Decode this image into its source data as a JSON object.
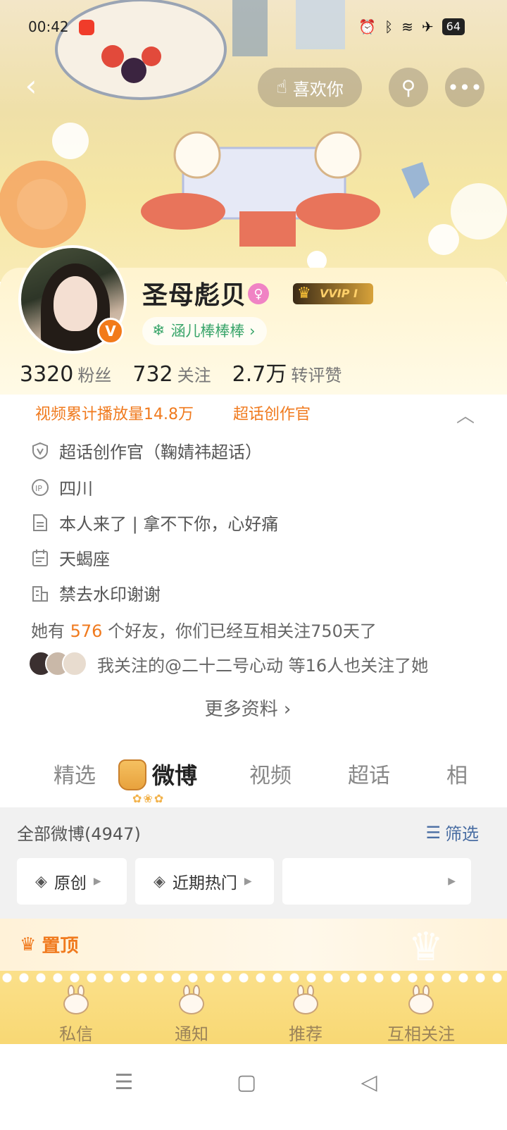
{
  "status_bar": {
    "time": "00:42",
    "battery": "64"
  },
  "top_nav": {
    "back_icon": "chevron-left-icon",
    "like_label": "喜欢你",
    "search_icon": "search-icon",
    "more_icon": "more-dots-icon"
  },
  "profile": {
    "username": "圣母彪贝",
    "gender": "female",
    "vip_label": "VVIP I",
    "fan_badge": "涵儿棒棒棒 ›",
    "stats": [
      {
        "value": "3320",
        "label": "粉丝"
      },
      {
        "value": "732",
        "label": "关注"
      },
      {
        "value": "2.7万",
        "label": "转评赞"
      }
    ]
  },
  "info": {
    "tags": [
      "视频累计播放量14.8万",
      "超话创作官"
    ],
    "rows": [
      {
        "icon": "shield-v-icon",
        "text": "超话创作官（鞠婧祎超话）"
      },
      {
        "icon": "ip-icon",
        "text": "四川"
      },
      {
        "icon": "document-icon",
        "text": "本人来了 | 拿不下你，心好痛"
      },
      {
        "icon": "calendar-icon",
        "text": "天蝎座"
      },
      {
        "icon": "building-icon",
        "text": "禁去水印谢谢"
      }
    ],
    "friends_prefix": "她有",
    "friends_count": "576",
    "friends_suffix": "个好友，你们已经互相关注750天了",
    "mutual_text": "我关注的@二十二号心动 等16人也关注了她",
    "more_info": "更多资料 ›"
  },
  "tabs": [
    {
      "label": "精选",
      "active": false
    },
    {
      "label": "微博",
      "active": true
    },
    {
      "label": "视频",
      "active": false
    },
    {
      "label": "超话",
      "active": false
    },
    {
      "label": "相",
      "active": false
    }
  ],
  "feed": {
    "count_label": "全部微博(4947)",
    "filter_label": "筛选",
    "chips": [
      {
        "label": "原创"
      },
      {
        "label": "近期热门"
      }
    ]
  },
  "pinned": {
    "label": "置顶"
  },
  "bottom_tabs": [
    {
      "label": "私信"
    },
    {
      "label": "通知"
    },
    {
      "label": "推荐"
    },
    {
      "label": "互相关注"
    }
  ],
  "colors": {
    "accent_orange": "#f07a1e",
    "fan_green": "#3aa56b",
    "filter_blue": "#4a6ea3"
  }
}
